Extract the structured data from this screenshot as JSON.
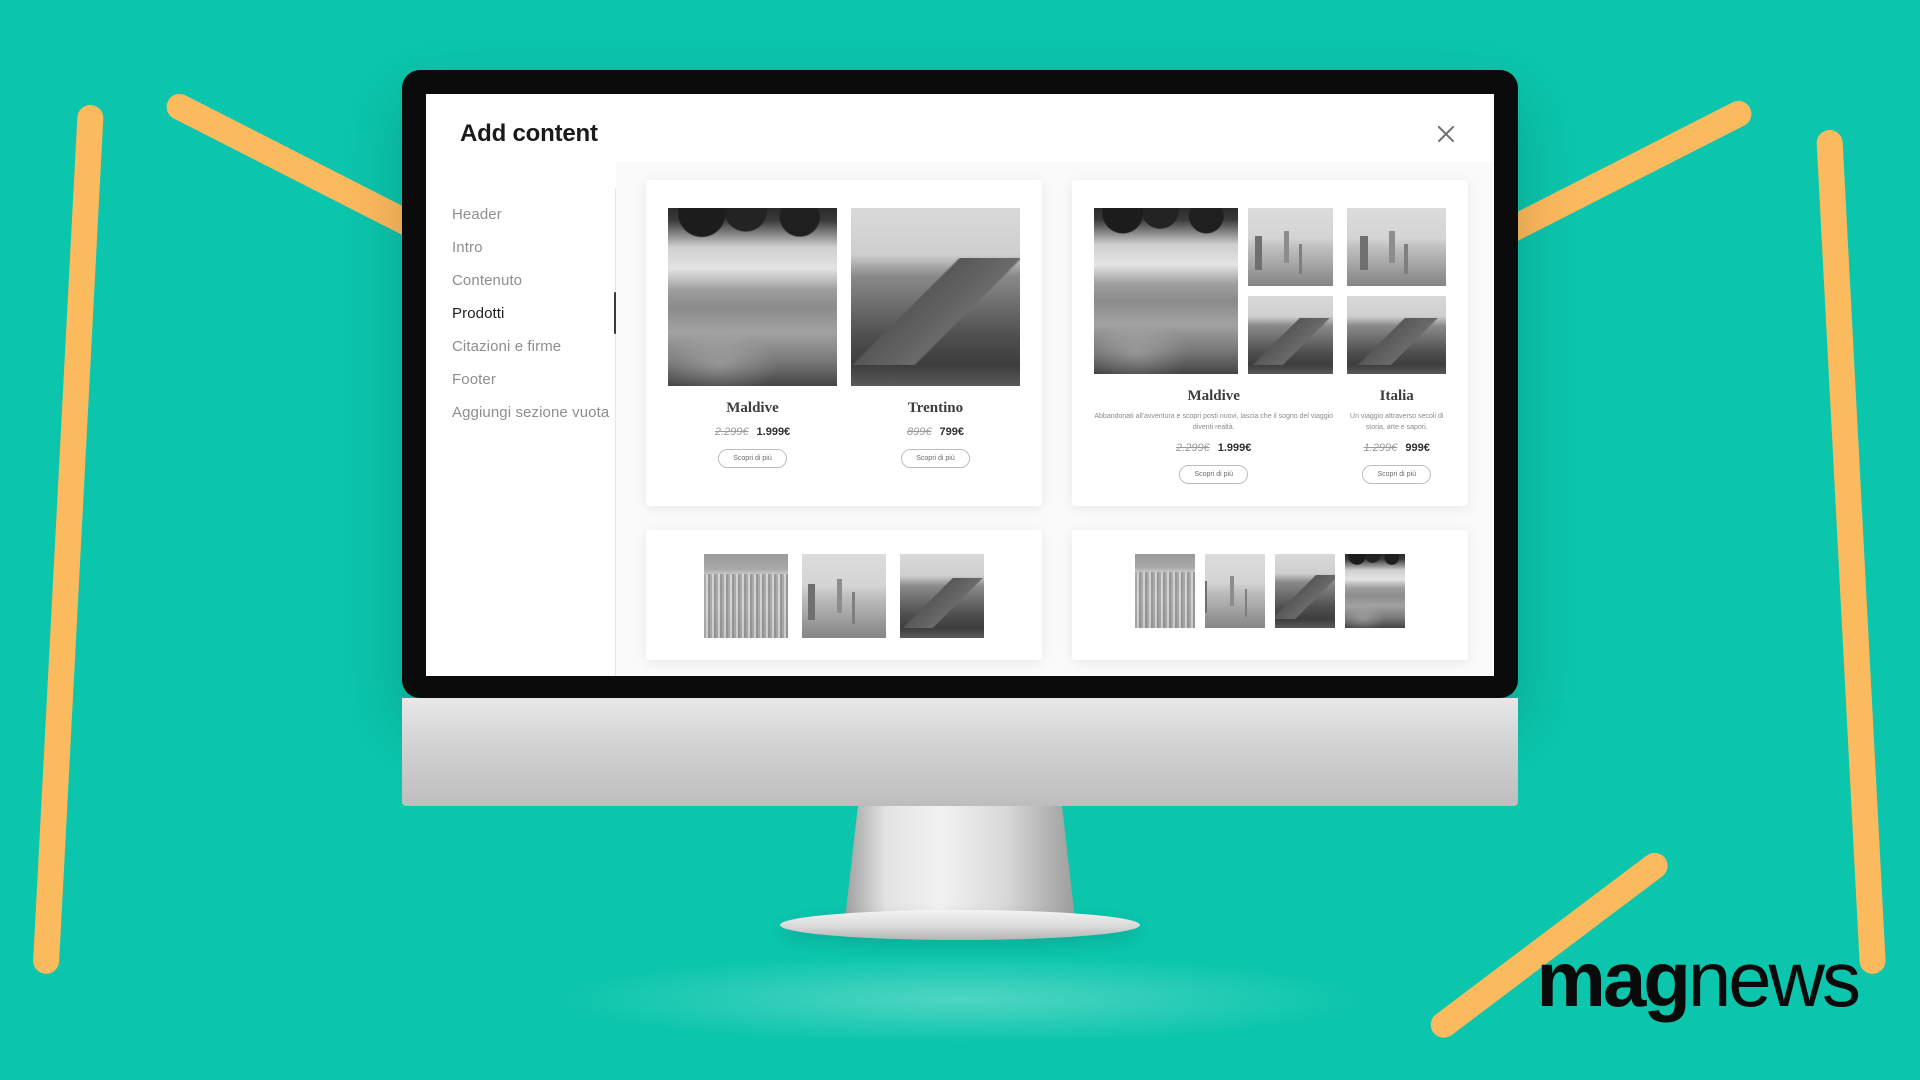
{
  "brand": {
    "logo_bold": "mag",
    "logo_light": "news",
    "teal": "#0BC5AC",
    "orange": "#FCBA5E"
  },
  "dialog": {
    "title": "Add content",
    "close_label": "×"
  },
  "sidebar": {
    "items": [
      {
        "label": "Header",
        "active": false
      },
      {
        "label": "Intro",
        "active": false
      },
      {
        "label": "Contenuto",
        "active": false
      },
      {
        "label": "Prodotti",
        "active": true
      },
      {
        "label": "Citazioni e firme",
        "active": false
      },
      {
        "label": "Footer",
        "active": false
      },
      {
        "label": "Aggiungi sezione vuota",
        "active": false
      }
    ]
  },
  "templates": [
    {
      "id": "two-products-simple",
      "items": [
        {
          "title": "Maldive",
          "price_old": "2.299€",
          "price_new": "1.999€",
          "cta": "Scopri di più",
          "photo": "p-lagoon"
        },
        {
          "title": "Trentino",
          "price_old": "899€",
          "price_new": "799€",
          "cta": "Scopri di più",
          "photo": "p-mount"
        }
      ]
    },
    {
      "id": "two-products-described",
      "items": [
        {
          "title": "Maldive",
          "desc": "Abbandonati all'avventura e scopri posti nuovi, lascia che il sogno del viaggio diventi realtà.",
          "price_old": "2.299€",
          "price_new": "1.999€",
          "cta": "Scopri di più",
          "photo": "p-lagoon"
        },
        {
          "title": "Italia",
          "desc": "Un viaggio attraverso secoli di storia, arte e sapori.",
          "price_old": "1.299€",
          "price_new": "999€",
          "cta": "Scopri di più",
          "photo": "p-duomo"
        }
      ]
    },
    {
      "id": "three-image-gallery",
      "photos": [
        "p-city",
        "p-duomo",
        "p-mount"
      ]
    },
    {
      "id": "four-image-gallery",
      "photos": [
        "p-city",
        "p-duomo",
        "p-mount",
        "p-lagoon"
      ]
    }
  ]
}
